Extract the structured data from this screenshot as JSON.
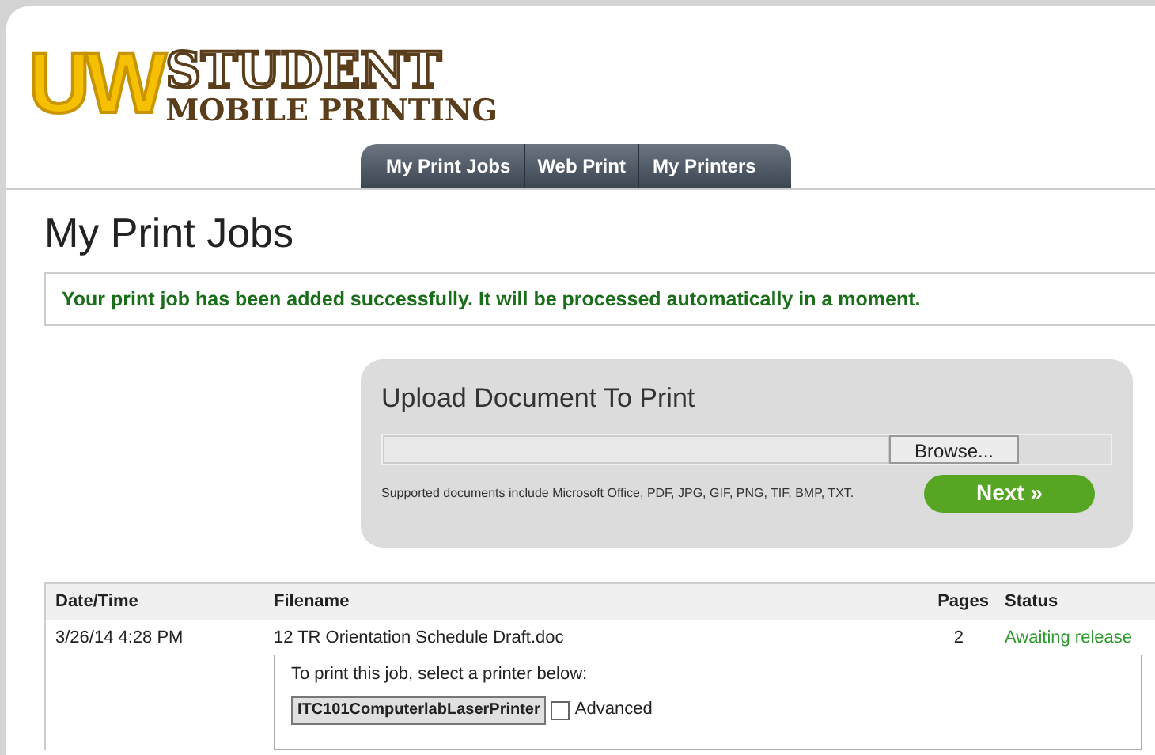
{
  "logo": {
    "big": "UW",
    "top": "STUDENT",
    "bottom": "MOBILE PRINTING"
  },
  "tabs": [
    {
      "label": "My Print Jobs"
    },
    {
      "label": "Web Print"
    },
    {
      "label": "My Printers"
    }
  ],
  "page_title": "My Print Jobs",
  "message": "Your print job has been added successfully. It will be processed automatically in a moment.",
  "upload": {
    "title": "Upload Document To Print",
    "browse": "Browse...",
    "note": "Supported documents include Microsoft Office, PDF, JPG, GIF, PNG, TIF, BMP, TXT.",
    "next": "Next »"
  },
  "table": {
    "columns": [
      "Date/Time",
      "Filename",
      "Pages",
      "Status"
    ],
    "rows": [
      {
        "date": "3/26/14 4:28 PM",
        "filename": "12 TR Orientation Schedule Draft.doc",
        "pages": "2",
        "status": "Awaiting release",
        "detail": {
          "prompt": "To print this job, select a printer below:",
          "printer": "ITC101ComputerlabLaserPrinter",
          "advanced": {
            "label": "Advanced",
            "checked": false
          }
        }
      }
    ]
  }
}
